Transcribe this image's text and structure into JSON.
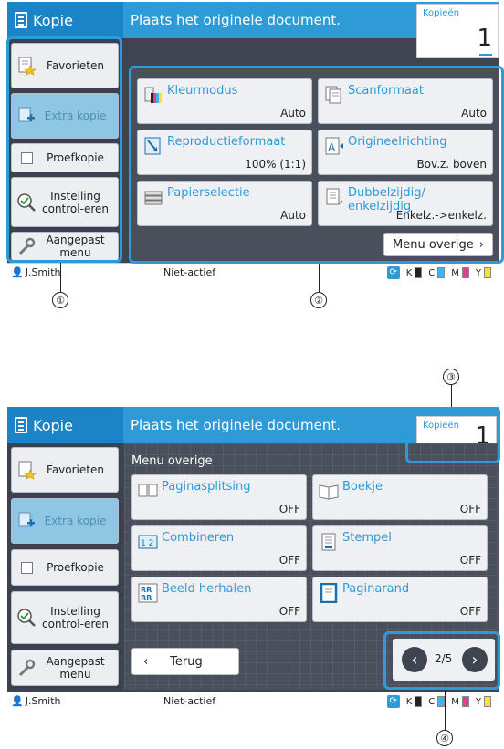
{
  "app": {
    "title": "Kopie",
    "message": "Plaats het originele document."
  },
  "copies": {
    "label": "Kopieën",
    "value": "1"
  },
  "sidebar": {
    "favorites": "Favorieten",
    "extra_copy": "Extra kopie",
    "proof_copy": "Proefkopie",
    "check_settings": "Instelling control-eren",
    "custom_menu": "Aangepast menu"
  },
  "functions": [
    {
      "name": "Kleurmodus",
      "value": "Auto"
    },
    {
      "name": "Scanformaat",
      "value": "Auto"
    },
    {
      "name": "Reproductieformaat",
      "value": "100% (1:1)"
    },
    {
      "name": "Origineelrichting",
      "value": "Bov.z. boven"
    },
    {
      "name": "Papierselectie",
      "value": "Auto"
    },
    {
      "name": "Dubbelzijdig/ enkelzijdig",
      "value": "Enkelz.->enkelz."
    }
  ],
  "more_menu_button": "Menu overige",
  "more_menu": {
    "title": "Menu overige",
    "items": [
      {
        "name": "Paginasplitsing",
        "value": "OFF"
      },
      {
        "name": "Boekje",
        "value": "OFF"
      },
      {
        "name": "Combineren",
        "value": "OFF"
      },
      {
        "name": "Stempel",
        "value": "OFF"
      },
      {
        "name": "Beeld herhalen",
        "value": "OFF"
      },
      {
        "name": "Paginarand",
        "value": "OFF"
      }
    ],
    "back": "Terug",
    "page": "2/5"
  },
  "status": {
    "user": "J.Smith",
    "activity": "Niet-actief",
    "inks": [
      {
        "label": "K",
        "color": "#222222"
      },
      {
        "label": "C",
        "color": "#3fb6e8"
      },
      {
        "label": "M",
        "color": "#e43d8e"
      },
      {
        "label": "Y",
        "color": "#f4e23a"
      }
    ]
  },
  "callouts": [
    "①",
    "②",
    "③",
    "④"
  ],
  "colors": {
    "accent": "#2e9bd6",
    "header": "#1a84c6",
    "body": "#3f4451"
  }
}
